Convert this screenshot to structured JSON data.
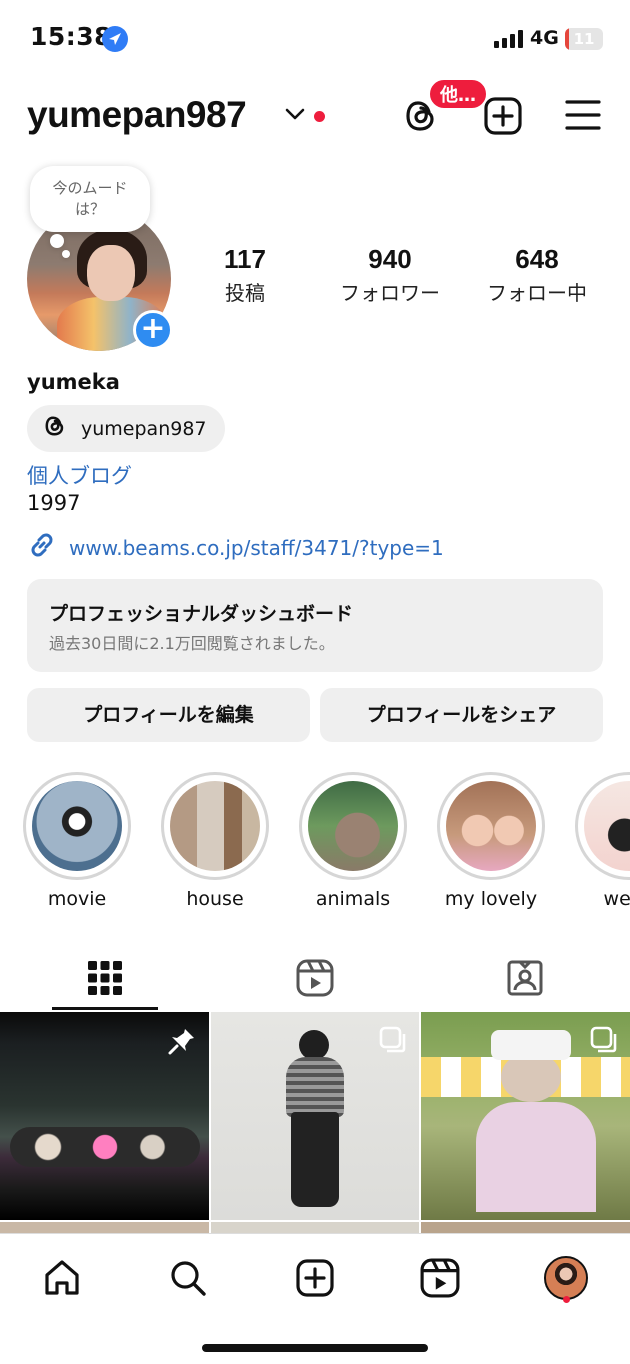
{
  "status_bar": {
    "time": "15:38",
    "network": "4G",
    "battery": "11",
    "battery_level": 0.11,
    "battery_color": "#e5463c"
  },
  "header": {
    "username": "yumepan987",
    "threads_badge": "他…"
  },
  "profile": {
    "note": "今のムード\nは？",
    "stats": [
      {
        "value": "117",
        "label": "投稿"
      },
      {
        "value": "940",
        "label": "フォロワー"
      },
      {
        "value": "648",
        "label": "フォロー中"
      }
    ],
    "full_name": "yumeka",
    "threads_handle": "yumepan987",
    "bio_link_text": "個人ブログ",
    "bio_text": "1997",
    "external_link": "www.beams.co.jp/staff/3471/?type=1"
  },
  "dashboard": {
    "title": "プロフェッショナルダッシュボード",
    "subtitle": "過去30日間に2.1万回閲覧されました。"
  },
  "buttons": {
    "edit_profile": "プロフィールを編集",
    "share_profile": "プロフィールをシェア"
  },
  "highlights": [
    {
      "label": "movie"
    },
    {
      "label": "house"
    },
    {
      "label": "animals"
    },
    {
      "label": "my lovely"
    },
    {
      "label": "wedo"
    }
  ],
  "tabs": [
    {
      "icon": "grid-icon",
      "active": true
    },
    {
      "icon": "reels-icon",
      "active": false
    },
    {
      "icon": "tagged-icon",
      "active": false
    }
  ],
  "nav": [
    "home-icon",
    "search-icon",
    "create-icon",
    "reels-icon",
    "profile-avatar"
  ],
  "colors": {
    "accent_blue": "#2f8cf1",
    "link_blue": "#2f6dbf",
    "notification_red": "#ee1d3d"
  }
}
